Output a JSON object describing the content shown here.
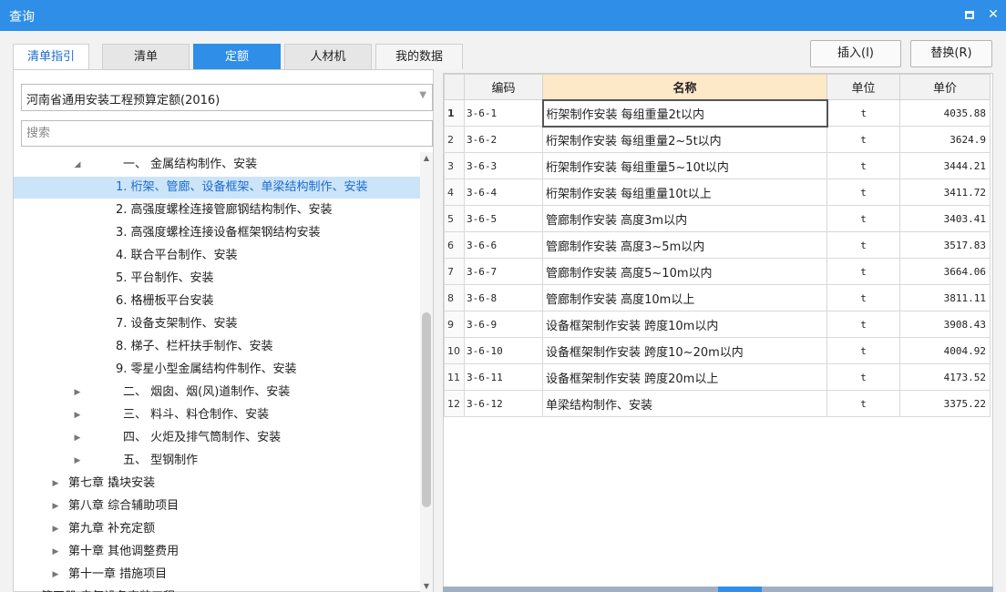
{
  "window": {
    "title": "查询"
  },
  "tabs": [
    "清单指引",
    "清单",
    "定额",
    "人材机",
    "我的数据"
  ],
  "active_tab": "定额",
  "quota_library": "河南省通用安装工程预算定额(2016)",
  "search": {
    "placeholder": "搜索",
    "value": ""
  },
  "buttons": {
    "insert": "插入(I)",
    "replace": "替换(R)"
  },
  "tree": [
    {
      "label": "一、 金属结构制作、安装",
      "state": "expanded",
      "level": 1,
      "selected": false
    },
    {
      "label": "1. 桁架、管廊、设备框架、单梁结构制作、安装",
      "state": "leaf",
      "level": 2,
      "selected": true
    },
    {
      "label": "2. 高强度螺栓连接管廊钢结构制作、安装",
      "state": "leaf",
      "level": 2,
      "selected": false
    },
    {
      "label": "3. 高强度螺栓连接设备框架钢结构安装",
      "state": "leaf",
      "level": 2,
      "selected": false
    },
    {
      "label": "4. 联合平台制作、安装",
      "state": "leaf",
      "level": 2,
      "selected": false
    },
    {
      "label": "5. 平台制作、安装",
      "state": "leaf",
      "level": 2,
      "selected": false
    },
    {
      "label": "6. 格栅板平台安装",
      "state": "leaf",
      "level": 2,
      "selected": false
    },
    {
      "label": "7. 设备支架制作、安装",
      "state": "leaf",
      "level": 2,
      "selected": false
    },
    {
      "label": "8. 梯子、栏杆扶手制作、安装",
      "state": "leaf",
      "level": 2,
      "selected": false
    },
    {
      "label": "9. 零星小型金属结构件制作、安装",
      "state": "leaf",
      "level": 2,
      "selected": false
    },
    {
      "label": "二、 烟囱、烟(风)道制作、安装",
      "state": "collapsed",
      "level": 1,
      "selected": false
    },
    {
      "label": "三、 料斗、料仓制作、安装",
      "state": "collapsed",
      "level": 1,
      "selected": false
    },
    {
      "label": "四、 火炬及排气筒制作、安装",
      "state": "collapsed",
      "level": 1,
      "selected": false
    },
    {
      "label": "五、 型钢制作",
      "state": "collapsed",
      "level": 1,
      "selected": false
    },
    {
      "label": "第七章 撬块安装",
      "state": "collapsed",
      "level": 0,
      "selected": false
    },
    {
      "label": "第八章 综合辅助项目",
      "state": "collapsed",
      "level": 0,
      "selected": false
    },
    {
      "label": "第九章 补充定额",
      "state": "collapsed",
      "level": 0,
      "selected": false
    },
    {
      "label": "第十章 其他调整费用",
      "state": "collapsed",
      "level": 0,
      "selected": false
    },
    {
      "label": "第十一章 措施项目",
      "state": "collapsed",
      "level": 0,
      "selected": false
    },
    {
      "label": "第四册 电气设备安装工程",
      "state": "collapsed",
      "level": -1,
      "selected": false
    }
  ],
  "table": {
    "headers": {
      "code": "编码",
      "name": "名称",
      "unit": "单位",
      "price": "单价"
    },
    "current_row": 1,
    "rows": [
      {
        "no": "1",
        "code": "3-6-1",
        "name": "桁架制作安装 每组重量2t以内",
        "unit": "t",
        "price": "4035.88"
      },
      {
        "no": "2",
        "code": "3-6-2",
        "name": "桁架制作安装 每组重量2~5t以内",
        "unit": "t",
        "price": "3624.9"
      },
      {
        "no": "3",
        "code": "3-6-3",
        "name": "桁架制作安装 每组重量5~10t以内",
        "unit": "t",
        "price": "3444.21"
      },
      {
        "no": "4",
        "code": "3-6-4",
        "name": "桁架制作安装 每组重量10t以上",
        "unit": "t",
        "price": "3411.72"
      },
      {
        "no": "5",
        "code": "3-6-5",
        "name": "管廊制作安装 高度3m以内",
        "unit": "t",
        "price": "3403.41"
      },
      {
        "no": "6",
        "code": "3-6-6",
        "name": "管廊制作安装 高度3~5m以内",
        "unit": "t",
        "price": "3517.83"
      },
      {
        "no": "7",
        "code": "3-6-7",
        "name": "管廊制作安装 高度5~10m以内",
        "unit": "t",
        "price": "3664.06"
      },
      {
        "no": "8",
        "code": "3-6-8",
        "name": "管廊制作安装 高度10m以上",
        "unit": "t",
        "price": "3811.11"
      },
      {
        "no": "9",
        "code": "3-6-9",
        "name": "设备框架制作安装 跨度10m以内",
        "unit": "t",
        "price": "3908.43"
      },
      {
        "no": "10",
        "code": "3-6-10",
        "name": "设备框架制作安装 跨度10~20m以内",
        "unit": "t",
        "price": "4004.92"
      },
      {
        "no": "11",
        "code": "3-6-11",
        "name": "设备框架制作安装 跨度20m以上",
        "unit": "t",
        "price": "4173.52"
      },
      {
        "no": "12",
        "code": "3-6-12",
        "name": "单梁结构制作、安装",
        "unit": "t",
        "price": "3375.22"
      }
    ]
  },
  "colors": {
    "accent": "#2f8ee8",
    "selection": "#cce4f7",
    "header_highlight": "#fde8c8"
  },
  "icons": {
    "maximize": "maximize-icon",
    "close": "close-icon",
    "dropdown": "chevron-down-icon",
    "expanded": "triangle-down-icon",
    "collapsed": "triangle-right-icon"
  }
}
